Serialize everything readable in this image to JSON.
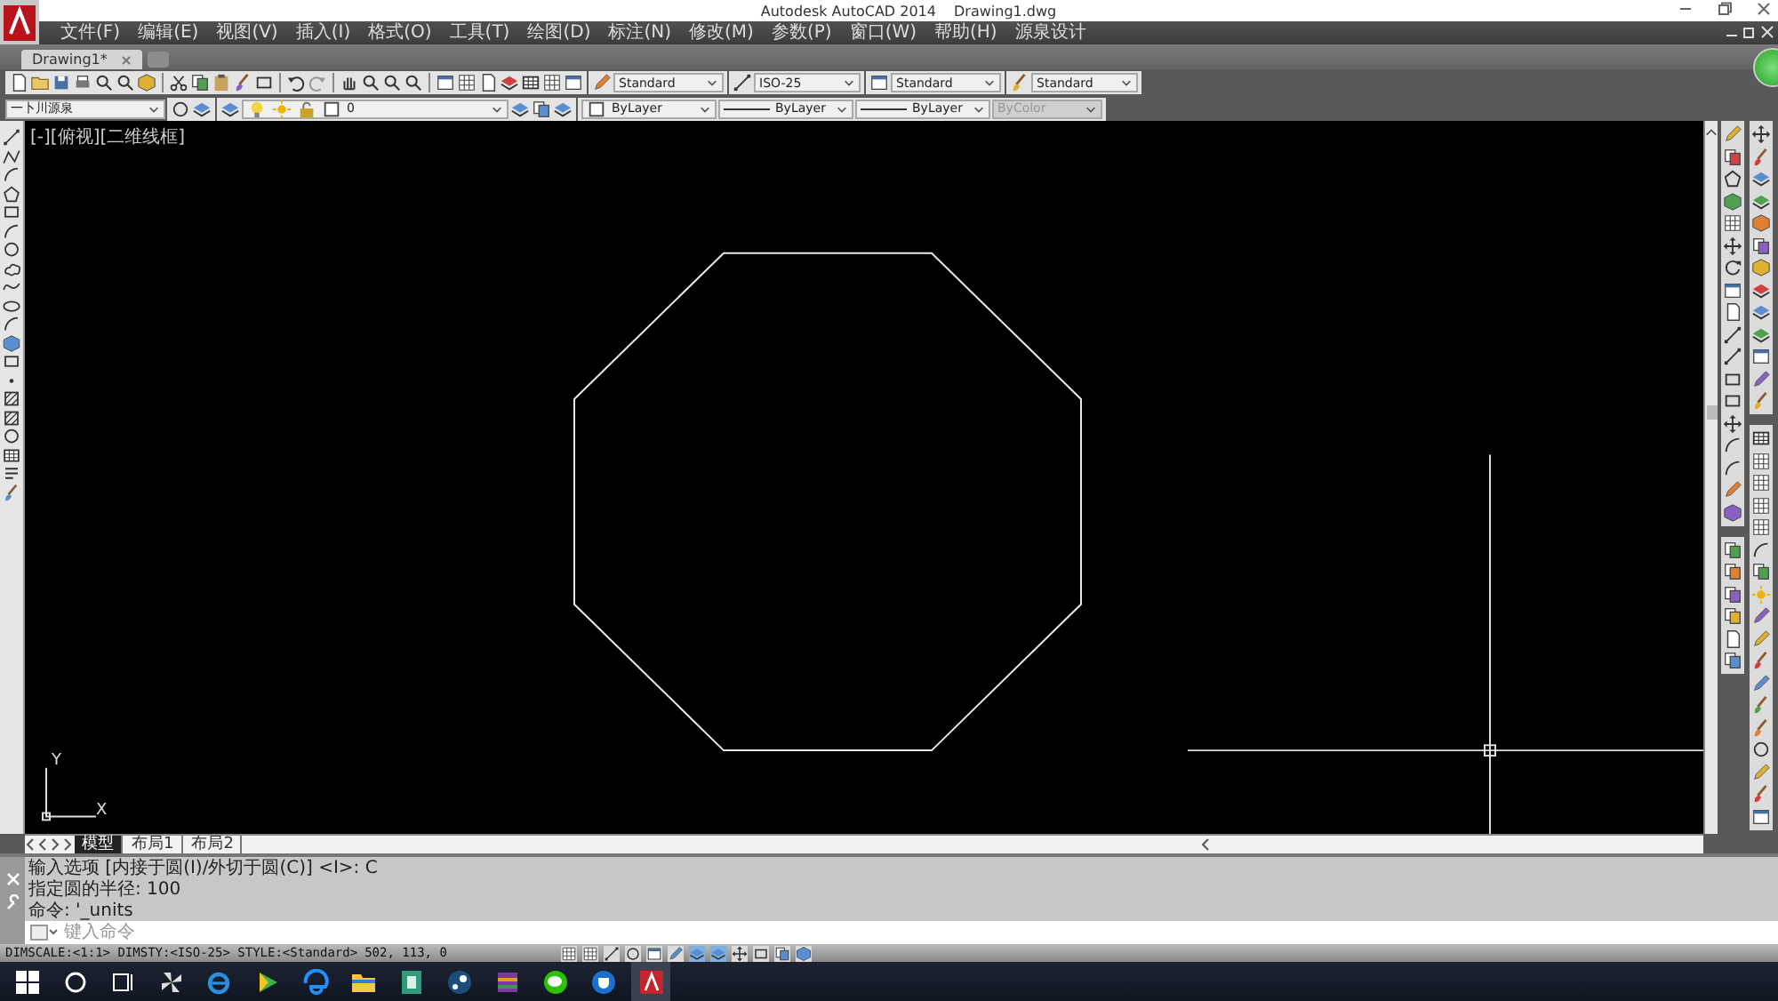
{
  "window": {
    "app": "Autodesk AutoCAD 2014",
    "file": "Drawing1.dwg"
  },
  "menu": [
    "文件(F)",
    "编辑(E)",
    "视图(V)",
    "插入(I)",
    "格式(O)",
    "工具(T)",
    "绘图(D)",
    "标注(N)",
    "修改(M)",
    "参数(P)",
    "窗口(W)",
    "帮助(H)",
    "源泉设计"
  ],
  "document_tabs": [
    {
      "label": "Drawing1*",
      "selected": true
    }
  ],
  "styles_toolbar": {
    "text_style": "Standard",
    "dim_style": "ISO-25",
    "table_style": "Standard",
    "multileader_style": "Standard"
  },
  "properties_bar": {
    "layer_state": "一卜川源泉",
    "layer": "0",
    "object_color": "ByLayer",
    "linetype": "ByLayer",
    "lineweight": "ByLayer",
    "plot_style": {
      "value": "ByColor",
      "disabled": true
    }
  },
  "viewport": {
    "label": "[-][俯视][二维线框]",
    "ucs_y": "Y",
    "ucs_x": "X"
  },
  "layout_tabs": [
    {
      "label": "模型",
      "selected": true
    },
    {
      "label": "布局1",
      "selected": false
    },
    {
      "label": "布局2",
      "selected": false
    }
  ],
  "command_history": [
    "输入选项 [内接于圆(I)/外切于圆(C)] <I>: C",
    "指定圆的半径: 100",
    "命令: '_units"
  ],
  "command_input": {
    "placeholder": "键入命令"
  },
  "status_bar": {
    "text": "DIMSCALE:<1:1> DIMSTY:<ISO-25> STYLE:<Standard>",
    "coordinates": "502, 113, 0"
  },
  "status_toggles": [
    {
      "on": false
    },
    {
      "on": false
    },
    {
      "on": false
    },
    {
      "on": false
    },
    {
      "on": false
    },
    {
      "on": false
    },
    {
      "on": true
    },
    {
      "on": true
    },
    {
      "on": false
    },
    {
      "on": false
    },
    {
      "on": false
    },
    {
      "on": false
    }
  ],
  "taskbar_apps": [
    {
      "active": false
    },
    {
      "active": false
    },
    {
      "active": false
    },
    {
      "active": false
    },
    {
      "active": false
    },
    {
      "active": false
    },
    {
      "active": false
    },
    {
      "active": false
    },
    {
      "active": false
    },
    {
      "active": false
    },
    {
      "active": true
    }
  ]
}
